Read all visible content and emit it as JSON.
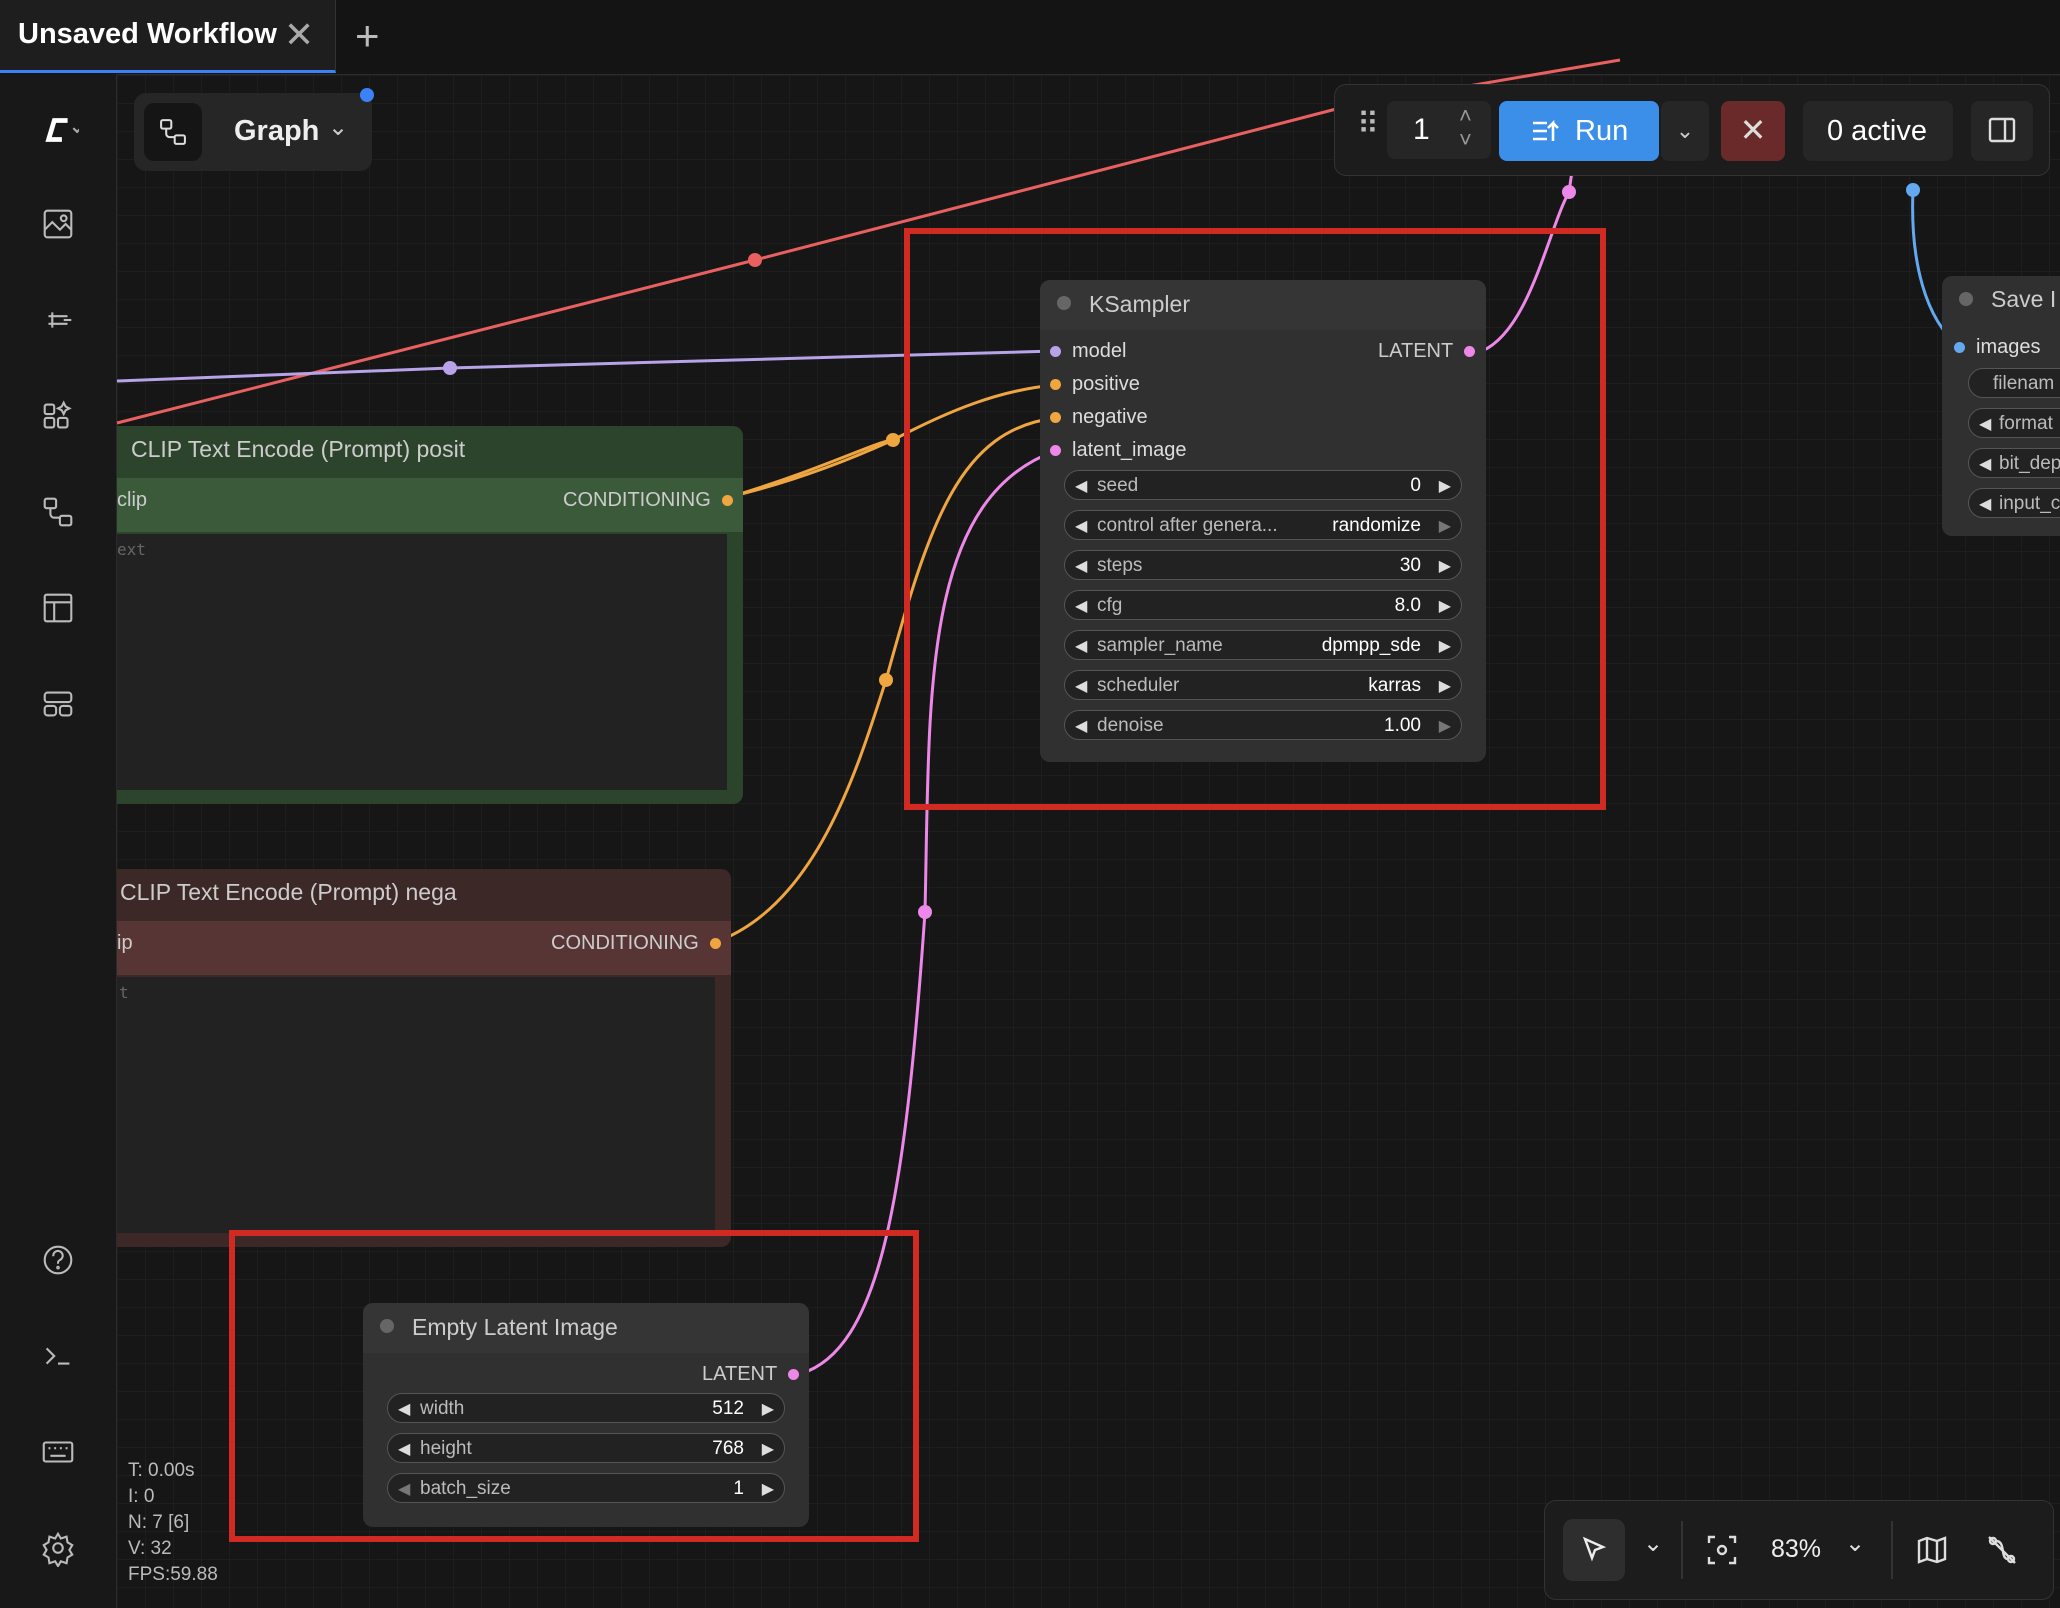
{
  "tab": {
    "title": "Unsaved Workflow"
  },
  "graph_selector": {
    "label": "Graph"
  },
  "toolbar": {
    "queue_count": "1",
    "run_label": "Run",
    "active_label": "0 active"
  },
  "nodes": {
    "ksampler": {
      "title": "KSampler",
      "inputs": [
        "model",
        "positive",
        "negative",
        "latent_image"
      ],
      "output": "LATENT",
      "widgets": [
        {
          "label": "seed",
          "value": "0"
        },
        {
          "label": "control after genera...",
          "value": "randomize"
        },
        {
          "label": "steps",
          "value": "30"
        },
        {
          "label": "cfg",
          "value": "8.0"
        },
        {
          "label": "sampler_name",
          "value": "dpmpp_sde"
        },
        {
          "label": "scheduler",
          "value": "karras"
        },
        {
          "label": "denoise",
          "value": "1.00"
        }
      ]
    },
    "clip_pos": {
      "title": "CLIP Text Encode (Prompt) posit",
      "input": "clip",
      "output": "CONDITIONING",
      "text_placeholder": "ext"
    },
    "clip_neg": {
      "title": "CLIP Text Encode (Prompt) nega",
      "input": "ip",
      "output": "CONDITIONING",
      "text_placeholder": "t"
    },
    "empty_latent": {
      "title": "Empty Latent Image",
      "output": "LATENT",
      "widgets": [
        {
          "label": "width",
          "value": "512"
        },
        {
          "label": "height",
          "value": "768"
        },
        {
          "label": "batch_size",
          "value": "1"
        }
      ]
    },
    "save_image": {
      "title": "Save I",
      "input": "images",
      "widgets": [
        "filenam",
        "format",
        "bit_dep",
        "input_c"
      ]
    }
  },
  "stats": {
    "t": "T: 0.00s",
    "i": "I: 0",
    "n": "N: 7 [6]",
    "v": "V: 32",
    "fps": "FPS:59.88"
  },
  "canvas_controls": {
    "zoom": "83%"
  },
  "colors": {
    "model_link": "#b8a3e8",
    "conditioning_link": "#f0a640",
    "latent_link": "#ee88e8",
    "clip_link": "#e86060",
    "image_link": "#64a8f0",
    "run_button": "#3b8fe8",
    "highlight_box": "#d12a22"
  }
}
